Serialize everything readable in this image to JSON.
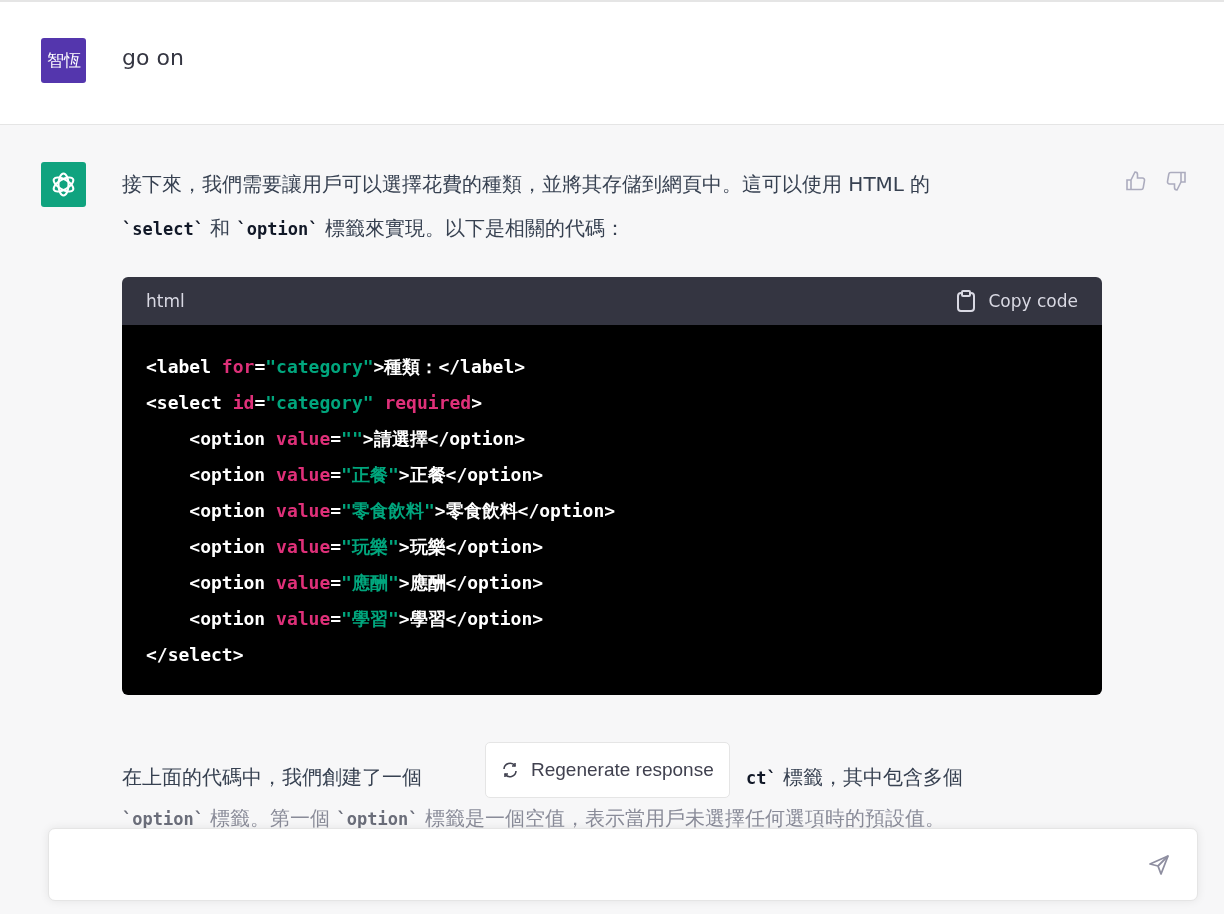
{
  "user_message": {
    "avatar": "智恆",
    "text": "go on"
  },
  "assistant_message": {
    "intro": [
      [
        {
          "kind": "text",
          "text": "接下來，我們需要讓用戶可以選擇花費的種類，並將其存儲到網頁中。這可以使用 HTML 的"
        }
      ],
      [
        {
          "kind": "code",
          "text": "`select`"
        },
        {
          "kind": "text",
          "text": " 和 "
        },
        {
          "kind": "code",
          "text": "`option`"
        },
        {
          "kind": "text",
          "text": " 標籤來實現。以下是相關的代碼："
        }
      ]
    ],
    "code_block": {
      "language": "html",
      "copy_label": "Copy code",
      "lines": [
        [
          {
            "kind": "tag",
            "text": "<label "
          },
          {
            "kind": "attr",
            "text": "for"
          },
          {
            "kind": "tag",
            "text": "="
          },
          {
            "kind": "str",
            "text": "\"category\""
          },
          {
            "kind": "tag",
            "text": ">種類：</label>"
          }
        ],
        [
          {
            "kind": "tag",
            "text": "<select "
          },
          {
            "kind": "attr",
            "text": "id"
          },
          {
            "kind": "tag",
            "text": "="
          },
          {
            "kind": "str",
            "text": "\"category\""
          },
          {
            "kind": "attr",
            "text": " required"
          },
          {
            "kind": "tag",
            "text": ">"
          }
        ],
        [
          {
            "kind": "tag",
            "text": "    <option "
          },
          {
            "kind": "attr",
            "text": "value"
          },
          {
            "kind": "tag",
            "text": "="
          },
          {
            "kind": "str",
            "text": "\"\""
          },
          {
            "kind": "tag",
            "text": ">請選擇</option>"
          }
        ],
        [
          {
            "kind": "tag",
            "text": "    <option "
          },
          {
            "kind": "attr",
            "text": "value"
          },
          {
            "kind": "tag",
            "text": "="
          },
          {
            "kind": "str",
            "text": "\"正餐\""
          },
          {
            "kind": "tag",
            "text": ">正餐</option>"
          }
        ],
        [
          {
            "kind": "tag",
            "text": "    <option "
          },
          {
            "kind": "attr",
            "text": "value"
          },
          {
            "kind": "tag",
            "text": "="
          },
          {
            "kind": "str",
            "text": "\"零食飲料\""
          },
          {
            "kind": "tag",
            "text": ">零食飲料</option>"
          }
        ],
        [
          {
            "kind": "tag",
            "text": "    <option "
          },
          {
            "kind": "attr",
            "text": "value"
          },
          {
            "kind": "tag",
            "text": "="
          },
          {
            "kind": "str",
            "text": "\"玩樂\""
          },
          {
            "kind": "tag",
            "text": ">玩樂</option>"
          }
        ],
        [
          {
            "kind": "tag",
            "text": "    <option "
          },
          {
            "kind": "attr",
            "text": "value"
          },
          {
            "kind": "tag",
            "text": "="
          },
          {
            "kind": "str",
            "text": "\"應酬\""
          },
          {
            "kind": "tag",
            "text": ">應酬</option>"
          }
        ],
        [
          {
            "kind": "tag",
            "text": "    <option "
          },
          {
            "kind": "attr",
            "text": "value"
          },
          {
            "kind": "tag",
            "text": "="
          },
          {
            "kind": "str",
            "text": "\"學習\""
          },
          {
            "kind": "tag",
            "text": ">學習</option>"
          }
        ],
        [
          {
            "kind": "tag",
            "text": "</select>"
          }
        ]
      ]
    },
    "after_line_1": [
      [
        {
          "kind": "text",
          "text": "在上面的代碼中，我們創建了一個"
        }
      ],
      [
        {
          "kind": "code",
          "text": "ct`"
        },
        {
          "kind": "text",
          "text": " 標籤，其中包含多個"
        }
      ]
    ],
    "after_line_2": [
      {
        "kind": "code",
        "text": "`option`"
      },
      {
        "kind": "text",
        "text": " 標籤。第一個 "
      },
      {
        "kind": "code",
        "text": "`option`"
      },
      {
        "kind": "text",
        "text": " 標籤是一個空值，表示當用戶未選擇任何選項時的預設值。"
      }
    ]
  },
  "regenerate_button": {
    "label": "Regenerate response"
  }
}
